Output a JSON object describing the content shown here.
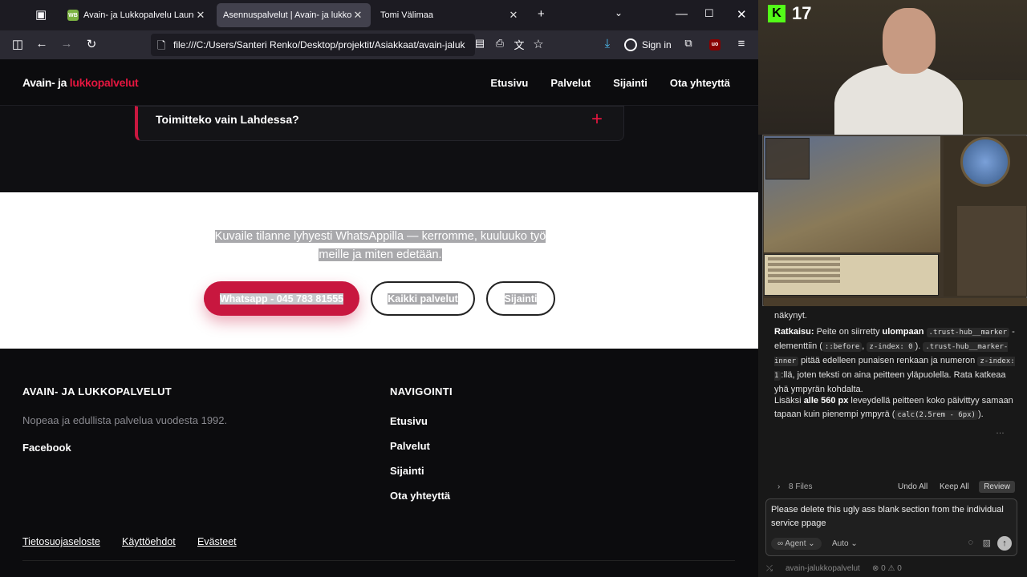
{
  "browser": {
    "tabs": [
      {
        "label": "Avain- ja Lukkopalvelu Laune O",
        "favicon": "WB",
        "active": false
      },
      {
        "label": "Asennuspalvelut | Avain- ja lukkopal",
        "active": true
      },
      {
        "label": "Tomi Välimaa",
        "active": false
      }
    ],
    "url": "file:///C:/Users/Santeri Renko/Desktop/projektit/Asiakkaat/avain-jaluk",
    "signin_label": "Sign in"
  },
  "site": {
    "logo_part1": "Avain- ja ",
    "logo_part2": "lukkopalvelut",
    "nav": [
      "Etusivu",
      "Palvelut",
      "Sijainti",
      "Ota yhteyttä"
    ],
    "faq_question": "Toimitteko vain Lahdessa?",
    "cta_text": "Kuvaile tilanne lyhyesti WhatsAppilla — kerromme, kuuluuko työ meille ja miten edetään.",
    "cta_buttons": [
      "Whatsapp - 045 783 81555",
      "Kaikki palvelut",
      "Sijainti"
    ],
    "footer": {
      "brand_heading": "AVAIN- JA LUKKOPALVELUT",
      "tagline": "Nopeaa ja edullista palvelua vuodesta 1992.",
      "facebook": "Facebook",
      "nav_heading": "NAVIGOINTI",
      "nav_links": [
        "Etusivu",
        "Palvelut",
        "Sijainti",
        "Ota yhteyttä"
      ],
      "legal": [
        "Tietosuojaseloste",
        "Käyttöehdot",
        "Evästeet"
      ]
    },
    "accent_color": "#e4163f"
  },
  "stream": {
    "platform_icon": "K",
    "viewer_count": "17"
  },
  "agent_panel": {
    "line_visible": "näkynyt.",
    "para1_label": "Ratkaisu:",
    "para1_a": "Peite on siirretty",
    "para1_b": "ulompaan",
    "code1": ".trust-hub__marker",
    "para1_c": "-elementtiin (",
    "code2": "::before",
    "code3": "z-index: 0",
    "para1_d": ").",
    "code4": ".trust-hub__marker-inner",
    "para1_e": "pitää edelleen punaisen renkaan ja numeron",
    "code5": "z-index: 1",
    "para1_f": ":llä, joten teksti on aina peitteen yläpuolella. Rata katkeaa yhä ympyrän kohdalta.",
    "para2_a": "Lisäksi",
    "para2_b": "alle 560 px",
    "para2_c": "leveydellä peitteen koko päivittyy samaan tapaan kuin pienempi ympyrä (",
    "code6": "calc(2.5rem - 6px)",
    "para2_d": ").",
    "files": "8 Files",
    "undo_all": "Undo All",
    "keep_all": "Keep All",
    "review": "Review",
    "input_text": "Please delete this ugly ass blank section from the individual service ppage",
    "mode": "Agent",
    "model": "Auto",
    "status_project": "avain-jalukkopalvelut",
    "status_counts": "⊗ 0 ⚠ 0"
  }
}
